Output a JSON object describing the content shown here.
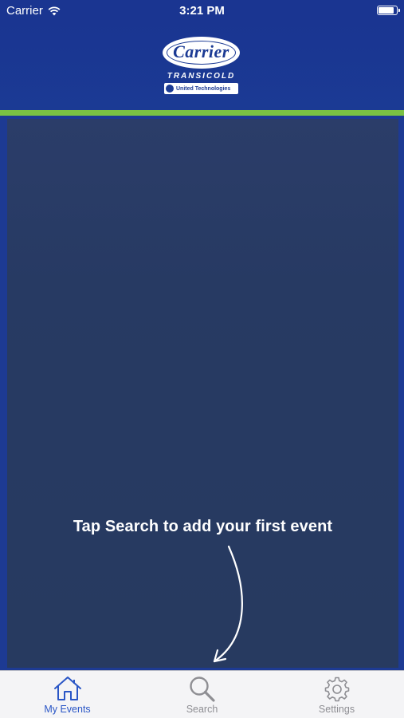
{
  "status_bar": {
    "carrier": "Carrier",
    "time": "3:21 PM",
    "battery_level": 0.9
  },
  "header": {
    "logo": {
      "brand": "Carrier",
      "sub": "TRANSICOLD",
      "parent": "United Technologies"
    }
  },
  "colors": {
    "nav_blue": "#1b3a94",
    "accent_green": "#7ac143",
    "panel": "#273a63",
    "tab_active": "#2a56c6",
    "tab_inactive": "#8e8e93"
  },
  "main": {
    "hint_text": "Tap Search to add your first event"
  },
  "tab_bar": {
    "tabs": [
      {
        "label": "My Events",
        "icon": "home-icon",
        "active": true
      },
      {
        "label": "Search",
        "icon": "search-icon",
        "active": false
      },
      {
        "label": "Settings",
        "icon": "gear-icon",
        "active": false
      }
    ]
  }
}
